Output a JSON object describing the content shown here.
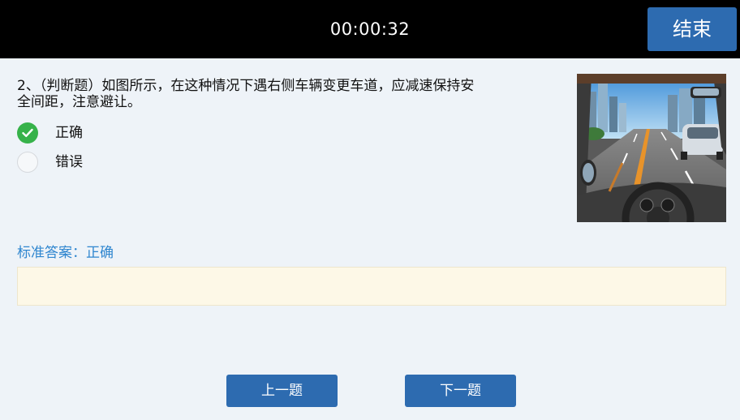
{
  "header": {
    "timer": "00:00:32",
    "end_label": "结束"
  },
  "question": {
    "text_line1": "2、（判断题）如图所示，在这种情况下遇右侧车辆变更车道，应减速保持安",
    "text_line2": "全间距，注意避让。",
    "options": [
      {
        "label": "正确",
        "selected": true
      },
      {
        "label": "错误",
        "selected": false
      }
    ]
  },
  "answer": {
    "label": "标准答案：正确",
    "explanation": ""
  },
  "nav": {
    "prev_label": "上一题",
    "next_label": "下一题"
  },
  "colors": {
    "topbar": "#000000",
    "button": "#2d6bb0",
    "checked": "#36b24a",
    "answer_text": "#2f86cf",
    "answer_box": "#fdf8e7"
  },
  "icons": {
    "selected": "check-icon",
    "scene": "driving-scene-image"
  }
}
